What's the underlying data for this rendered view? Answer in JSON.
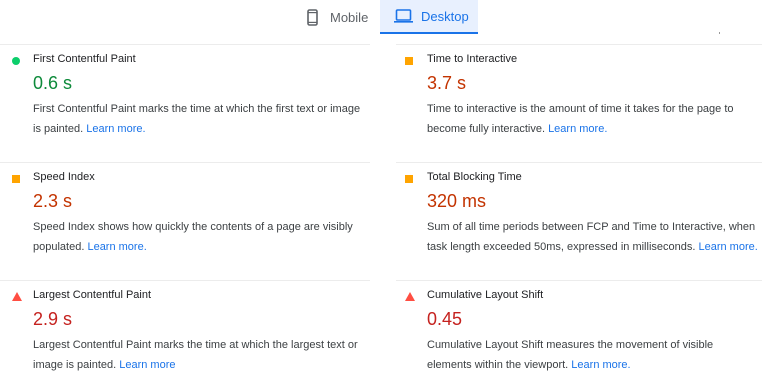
{
  "tabs": {
    "mobile_label": "Mobile",
    "desktop_label": "Desktop",
    "active": "Desktop"
  },
  "colors": {
    "accent": "#1a73e8",
    "pass": "#0cce6b",
    "average": "#ffa400",
    "fail": "#ff4e42"
  },
  "metrics": [
    {
      "title": "First Contentful Paint",
      "value": "0.6 s",
      "status": "pass",
      "icon": "green-circle-icon",
      "description": "First Contentful Paint marks the time at which the first text or image is painted.",
      "link": "Learn more."
    },
    {
      "title": "Time to Interactive",
      "value": "3.7 s",
      "status": "average",
      "icon": "orange-square-icon",
      "description": "Time to interactive is the amount of time it takes for the page to become fully interactive.",
      "link": "Learn more."
    },
    {
      "title": "Speed Index",
      "value": "2.3 s",
      "status": "average",
      "icon": "orange-square-icon",
      "description": "Speed Index shows how quickly the contents of a page are visibly populated.",
      "link": "Learn more."
    },
    {
      "title": "Total Blocking Time",
      "value": "320 ms",
      "status": "average",
      "icon": "orange-square-icon",
      "description": "Sum of all time periods between FCP and Time to Interactive, when task length exceeded 50ms, expressed in milliseconds.",
      "link": "Learn more."
    },
    {
      "title": "Largest Contentful Paint",
      "value": "2.9 s",
      "status": "fail",
      "icon": "red-triangle-icon",
      "description": "Largest Contentful Paint marks the time at which the largest text or image is painted.",
      "link": "Learn more"
    },
    {
      "title": "Cumulative Layout Shift",
      "value": "0.45",
      "status": "fail",
      "icon": "red-triangle-icon",
      "description": "Cumulative Layout Shift measures the movement of visible elements within the viewport.",
      "link": "Learn more."
    }
  ]
}
